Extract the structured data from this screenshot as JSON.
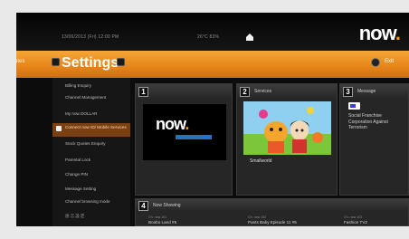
{
  "status": {
    "date": "13/06/2013 (Fri) 12:00 PM",
    "weather": "26°C 83%"
  },
  "logo": {
    "text": "now"
  },
  "header": {
    "lead": "utes",
    "title": "Settings",
    "exit_label": "Exit"
  },
  "menu": {
    "items": [
      {
        "label": "Billing Enquiry"
      },
      {
        "label": "Channel Management"
      },
      {
        "label": "My now DOLLAR"
      },
      {
        "label": "Connect now ID/ Mobile Services"
      },
      {
        "label": "Stock Quotes Enquiry"
      },
      {
        "label": "Parental Lock"
      },
      {
        "label": "Change PIN"
      },
      {
        "label": "Message Setting"
      },
      {
        "label": "Channel browsing mode"
      },
      {
        "label": "語言設定"
      }
    ]
  },
  "panels": {
    "p1": {
      "num": "1",
      "label": "",
      "logo": "now"
    },
    "p2": {
      "num": "2",
      "label": "Services",
      "caption": "Smallworld"
    },
    "p3": {
      "num": "3",
      "label": "Message",
      "text": "Social Franchise Corporation Against Terrorism"
    },
    "p4": {
      "num": "4",
      "label": "Now Showing",
      "columns": [
        {
          "sub": "Ch. now 101",
          "title": "Boobo Land #5"
        },
        {
          "sub": "Ch. now 102",
          "title": "Pants Baby Episode 11 #5"
        },
        {
          "sub": "Ch. now 103",
          "title": "Fashion TV2"
        }
      ]
    }
  },
  "colors": {
    "accent": "#e8871a",
    "selection": "#7a4012",
    "brand_dot": "#f39a12"
  }
}
